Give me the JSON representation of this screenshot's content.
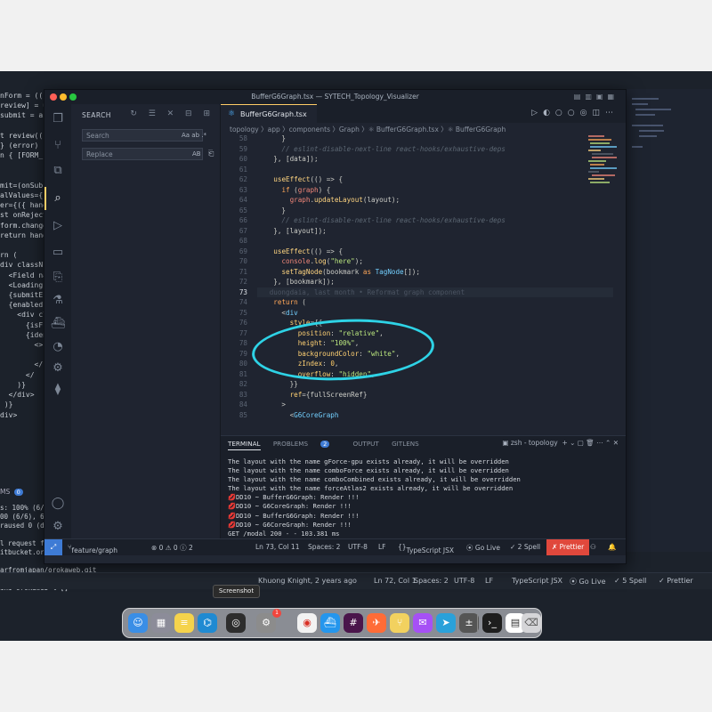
{
  "window": {
    "title": "BufferG6Graph.tsx — SYTECH_Topology_Visualizer"
  },
  "activity_bar": [
    "explorer-icon",
    "source-control-icon",
    "extensions-icon",
    "search-icon",
    "run-debug-icon",
    "remote-explorer-icon",
    "testing-icon",
    "accounts-icon",
    "settings-icon"
  ],
  "sidebar": {
    "title": "SEARCH",
    "search_placeholder": "Search",
    "search_options": "Aa ab .*",
    "replace_placeholder": "Replace",
    "replace_option": "AB"
  },
  "tab": {
    "label": "BufferG6Graph.tsx"
  },
  "breadcrumb": "topology 〉app 〉components 〉Graph 〉⚛ BufferG6Graph.tsx 〉⚛ BufferG6Graph",
  "code": {
    "blame": "duongdaia, last month • Reformat graph component",
    "lines": [
      {
        "n": "58",
        "text": "      }"
      },
      {
        "n": "59",
        "text": "      // eslint-disable-next-line react-hooks/exhaustive-deps"
      },
      {
        "n": "60",
        "text": "    }, [data]);"
      },
      {
        "n": "61",
        "text": ""
      },
      {
        "n": "62",
        "text": "    useEffect(() => {"
      },
      {
        "n": "63",
        "text": "      if (graph) {"
      },
      {
        "n": "64",
        "text": "        graph.updateLayout(layout);"
      },
      {
        "n": "65",
        "text": "      }"
      },
      {
        "n": "66",
        "text": "      // eslint-disable-next-line react-hooks/exhaustive-deps"
      },
      {
        "n": "67",
        "text": "    }, [layout]);"
      },
      {
        "n": "68",
        "text": ""
      },
      {
        "n": "69",
        "text": "    useEffect(() => {"
      },
      {
        "n": "70",
        "text": "      console.log(\"here\");"
      },
      {
        "n": "71",
        "text": "      setTagNode(bookmark as TagNode[]);"
      },
      {
        "n": "72",
        "text": "    }, [bookmark]);"
      },
      {
        "n": "73",
        "text": ""
      },
      {
        "n": "74",
        "text": "    return ("
      },
      {
        "n": "75",
        "text": "      <div"
      },
      {
        "n": "76",
        "text": "        style={{"
      },
      {
        "n": "77",
        "text": "          position: \"relative\","
      },
      {
        "n": "78",
        "text": "          height: \"100%\","
      },
      {
        "n": "79",
        "text": "          backgroundColor: \"white\","
      },
      {
        "n": "80",
        "text": "          zIndex: 0,"
      },
      {
        "n": "81",
        "text": "          overflow: \"hidden\","
      },
      {
        "n": "82",
        "text": "        }}"
      },
      {
        "n": "83",
        "text": "        ref={fullScreenRef}"
      },
      {
        "n": "84",
        "text": "      >"
      },
      {
        "n": "85",
        "text": "        <G6CoreGraph"
      }
    ]
  },
  "panel": {
    "tabs": [
      "TERMINAL",
      "PROBLEMS",
      "OUTPUT",
      "GITLENS"
    ],
    "problems_count": "2",
    "shell": "zsh - topology",
    "terminal": [
      "The layout with the name gForce-gpu exists already, it will be overridden",
      "The layout with the name comboForce exists already, it will be overridden",
      "The layout with the name comboCombined exists already, it will be overridden",
      "The layout with the name forceAtlas2 exists already, it will be overridden",
      "💋DD10 ~ BufferG6Graph: Render !!!",
      "💋DD10 ~ G6CoreGraph: Render !!!",
      "💋DD10 ~ BufferG6Graph: Render !!!",
      "💋DD10 ~ G6CoreGraph: Render !!!",
      "GET /modal 200 - - 103.381 ms"
    ]
  },
  "statusbar": {
    "branch": "feature/graph",
    "sync": "⊗ 0 ⚠ 0 ⓘ 2",
    "position": "Ln 73, Col 11",
    "spaces": "Spaces: 2",
    "encoding": "UTF-8",
    "eol": "LF",
    "language": "TypeScript JSX",
    "golive": "⦿ Go Live",
    "spell": "✓ 2 Spell",
    "prettier": "✗ Prettier"
  },
  "background_window": {
    "code": [
      "nForm = ((",
      "review] = us",
      "submit = as",
      "",
      "t review((",
      "} (error) {",
      "n { [FORM_",
      "",
      "",
      "mit=(onSub",
      "alValues={",
      "er={({ hand",
      "st onReject",
      "form.change",
      "return hand",
      "",
      "rn (",
      "div classN",
      "  <Field na",
      "  <Loading",
      "  {submitEr",
      "  {enabled",
      "    <div cl",
      "      {isF",
      "      {iden",
      "        <>",
      "",
      "        </",
      "      </",
      "    )}",
      "  </div>",
      " )}",
      "div>"
    ],
    "panel_label": "MS",
    "terminal": [
      "s: 100% (6/6",
      "00 (6/6), 6.",
      "raused 0 (d",
      "",
      "l request fo",
      "itbucket.org",
      "",
      "arfromjapan/orokaweb.git",
      "   admin/indentity-update -> admin/indentity-update",
      "ini orokaweb % []"
    ],
    "status": {
      "blame": "Khuong Knight, 2 years ago",
      "position": "Ln 72, Col 1",
      "spaces": "Spaces: 2",
      "encoding": "UTF-8",
      "eol": "LF",
      "language": "TypeScript JSX",
      "golive": "⦿ Go Live",
      "spell": "✓ 5 Spell",
      "prettier": "✓ Prettier"
    }
  },
  "dock": {
    "tooltip": "Screenshot",
    "apps": [
      "finder-icon",
      "launchpad-icon",
      "notes-icon",
      "vscode-icon",
      "screenshot-icon",
      "system-settings-icon",
      "chrome-icon",
      "docker-icon",
      "slack-icon",
      "postman-icon",
      "fork-icon",
      "messenger-icon",
      "telegram-icon",
      "calculator-icon",
      "terminal-icon",
      "preview-icon",
      "trash-icon"
    ],
    "settings_badge": "1"
  }
}
